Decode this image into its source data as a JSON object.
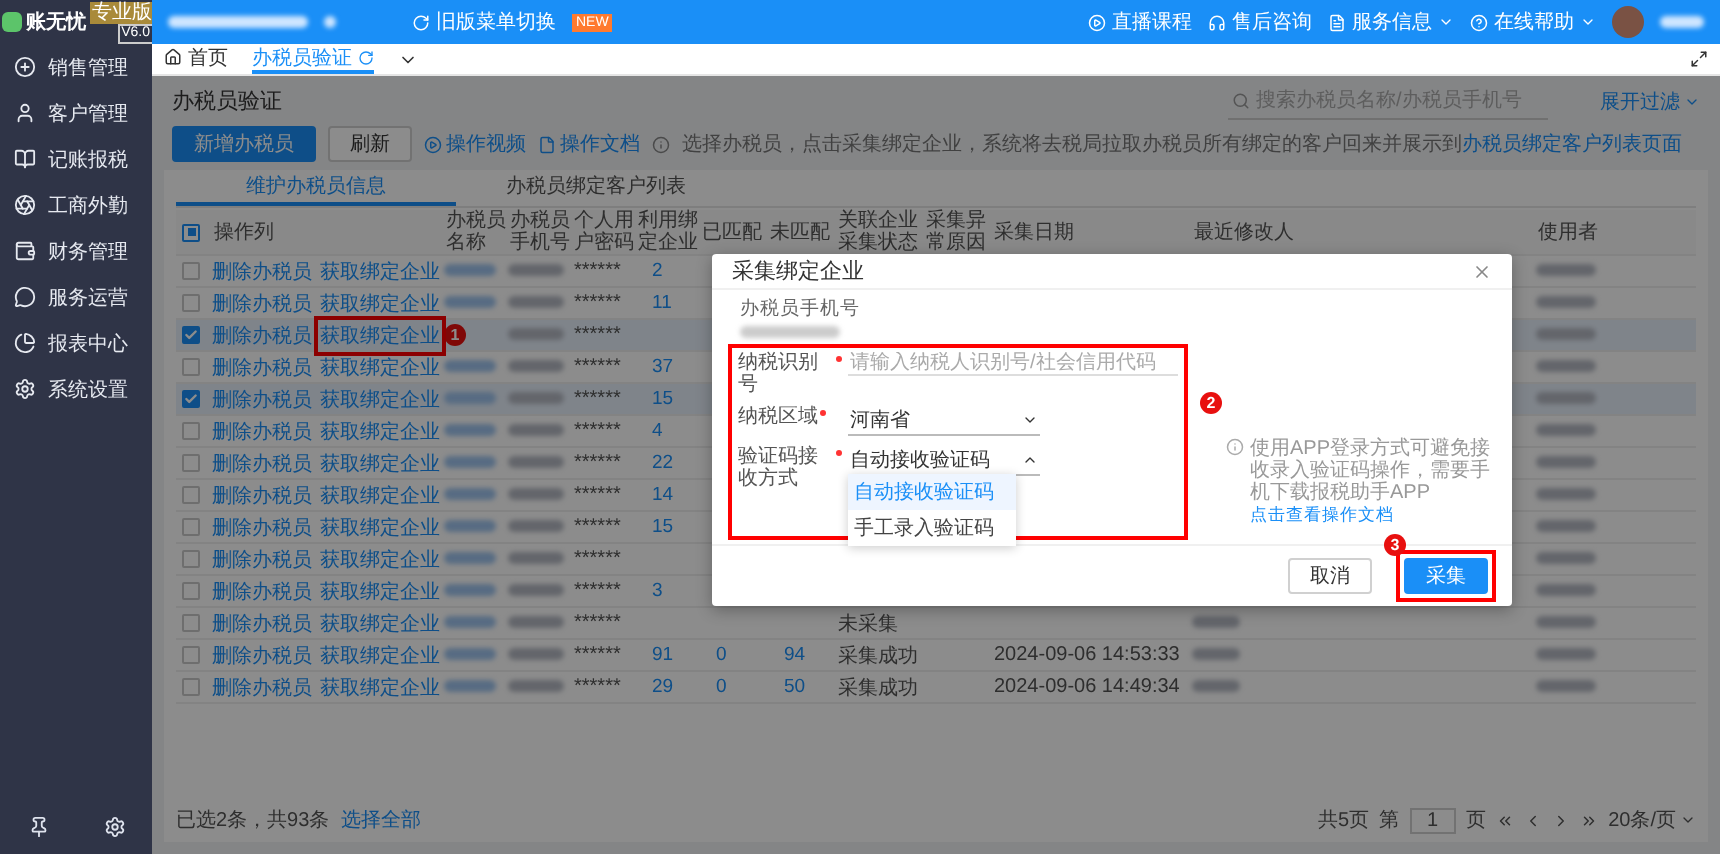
{
  "app": {
    "logo": "账无忧",
    "version": "V6.0",
    "edition": "专业版"
  },
  "topbar": {
    "menu_switch": "旧版菜单切换",
    "new_badge": "NEW",
    "links": [
      {
        "label": "直播课程",
        "dropdown": false
      },
      {
        "label": "售后咨询",
        "dropdown": false
      },
      {
        "label": "服务信息",
        "dropdown": true
      },
      {
        "label": "在线帮助",
        "dropdown": true
      }
    ]
  },
  "sidebar": {
    "items": [
      {
        "label": "销售管理"
      },
      {
        "label": "客户管理"
      },
      {
        "label": "记账报税"
      },
      {
        "label": "工商外勤"
      },
      {
        "label": "财务管理"
      },
      {
        "label": "服务运营"
      },
      {
        "label": "报表中心"
      },
      {
        "label": "系统设置"
      }
    ]
  },
  "tabs": [
    {
      "label": "首页",
      "selected": false
    },
    {
      "label": "办税员验证",
      "selected": true
    }
  ],
  "page": {
    "title": "办税员验证",
    "buttons": [
      {
        "label": "新增办税员",
        "kind": "primary"
      },
      {
        "label": "刷新",
        "kind": "default"
      }
    ],
    "links": [
      "操作视频",
      "操作文档"
    ],
    "hint": "选择办税员，点击采集绑定企业，系统将去税局拉取办税员所有绑定的客户回来并展示到",
    "hint_link": "办税员绑定客户列表页面",
    "search": {
      "placeholder": "搜索办税员名称/办税员手机号"
    },
    "filter": "展开过滤"
  },
  "subtabs": [
    {
      "label": "维护办税员信息",
      "selected": true
    },
    {
      "label": "办税员绑定客户列表",
      "selected": false
    }
  ],
  "table": {
    "select_all": {
      "indeterminate": true
    },
    "columns": [
      "操作列",
      "办税员名称",
      "办税员手机号",
      "个人用户密码",
      "利用绑定企业",
      "已匹配",
      "未匹配",
      "关联企业采集状态",
      "采集异常原因",
      "采集日期",
      "最近修改人",
      "使用者"
    ],
    "rows": [
      {
        "checked": false,
        "delete": "删除办税员",
        "fetch": "获取绑定企业",
        "password": "******",
        "bound": "2"
      },
      {
        "checked": false,
        "delete": "删除办税员",
        "fetch": "获取绑定企业",
        "password": "******",
        "bound": "11"
      },
      {
        "checked": true,
        "delete": "删除办税员",
        "fetch": "获取绑定企业",
        "password": "******",
        "annotation": "1"
      },
      {
        "checked": false,
        "delete": "删除办税员",
        "fetch": "获取绑定企业",
        "password": "******",
        "bound": "37"
      },
      {
        "checked": true,
        "delete": "删除办税员",
        "fetch": "获取绑定企业",
        "password": "******",
        "bound": "15"
      },
      {
        "checked": false,
        "delete": "删除办税员",
        "fetch": "获取绑定企业",
        "password": "******",
        "bound": "4"
      },
      {
        "checked": false,
        "delete": "删除办税员",
        "fetch": "获取绑定企业",
        "password": "******",
        "bound": "22"
      },
      {
        "checked": false,
        "delete": "删除办税员",
        "fetch": "获取绑定企业",
        "password": "******",
        "bound": "14"
      },
      {
        "checked": false,
        "delete": "删除办税员",
        "fetch": "获取绑定企业",
        "password": "******",
        "bound": "15"
      },
      {
        "checked": false,
        "delete": "删除办税员",
        "fetch": "获取绑定企业",
        "password": "******"
      },
      {
        "checked": false,
        "delete": "删除办税员",
        "fetch": "获取绑定企业",
        "password": "******",
        "bound": "3"
      },
      {
        "checked": false,
        "delete": "删除办税员",
        "fetch": "获取绑定企业",
        "password": "******",
        "status": "未采集"
      },
      {
        "checked": false,
        "delete": "删除办税员",
        "fetch": "获取绑定企业",
        "password": "******",
        "bound": "91",
        "matched": "0",
        "unmatched": "94",
        "status": "采集成功",
        "date": "2024-09-06 14:53:33"
      },
      {
        "checked": false,
        "delete": "删除办税员",
        "fetch": "获取绑定企业",
        "password": "******",
        "bound": "29",
        "matched": "0",
        "unmatched": "50",
        "status": "采集成功",
        "date": "2024-09-06 14:49:34"
      }
    ]
  },
  "footer": {
    "selection": "已选2条，共93条",
    "select_all": "选择全部",
    "pages": "共5页",
    "page_prefix": "第",
    "page": "1",
    "page_suffix": "页",
    "page_size": "20条/页"
  },
  "modal": {
    "title": "采集绑定企业",
    "phone_label": "办税员手机号",
    "annotation": "2",
    "fields": [
      {
        "label": "纳税识别号",
        "required": true,
        "kind": "input",
        "placeholder": "请输入纳税人识别号/社会信用代码"
      },
      {
        "label": "纳税区域",
        "required": true,
        "kind": "select",
        "value": "河南省",
        "expanded": false
      },
      {
        "label": "验证码接收方式",
        "required": true,
        "kind": "select",
        "value": "自动接收验证码",
        "expanded": true,
        "options": [
          {
            "label": "自动接收验证码",
            "selected": true
          },
          {
            "label": "手工录入验证码",
            "selected": false
          }
        ],
        "note": "使用APP登录方式可避免接收录入验证码操作，需要手机下载报税助手APP",
        "note_link": "点击查看操作文档"
      }
    ],
    "buttons": [
      {
        "label": "取消",
        "kind": "default"
      },
      {
        "label": "采集",
        "kind": "primary",
        "annotation": "3"
      }
    ]
  }
}
